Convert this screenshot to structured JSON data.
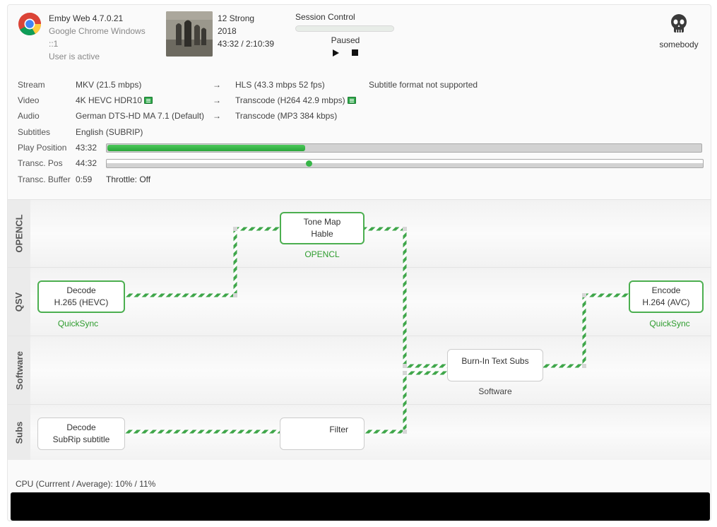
{
  "client": {
    "app": "Emby Web 4.7.0.21",
    "browser": "Google Chrome Windows",
    "address": "::1",
    "status": "User is active",
    "browser_icon": "chrome-icon"
  },
  "media": {
    "title": "12 Strong",
    "year": "2018",
    "time": "43:32 / 2:10:39"
  },
  "session": {
    "title": "Session Control",
    "state": "Paused",
    "play_icon": "play-icon",
    "stop_icon": "stop-icon"
  },
  "user": {
    "name": "somebody",
    "avatar_icon": "skull-icon"
  },
  "info": {
    "stream": {
      "label": "Stream",
      "source": "MKV (21.5 mbps)",
      "arrow": "→",
      "target": "HLS (43.3 mbps 52 fps)",
      "note": "Subtitle format not supported"
    },
    "video": {
      "label": "Video",
      "source": "4K HEVC HDR10",
      "arrow": "→",
      "target": "Transcode (H264 42.9 mbps)"
    },
    "audio": {
      "label": "Audio",
      "source": "German DTS-HD MA 7.1 (Default)",
      "arrow": "→",
      "target": "Transcode (MP3 384 kbps)"
    },
    "subtitles": {
      "label": "Subtitles",
      "source": "English (SUBRIP)"
    },
    "play_position": {
      "label": "Play Position",
      "value": "43:32",
      "progress": 0.333
    },
    "transc_pos": {
      "label": "Transc. Pos",
      "value": "44:32",
      "progress": 0.34
    },
    "transc_buffer": {
      "label": "Transc. Buffer",
      "value": "0:59",
      "throttle": "Throttle: Off"
    }
  },
  "pipeline": {
    "lanes": [
      "OPENCL",
      "QSV",
      "Software",
      "Subs"
    ],
    "nodes": {
      "tonemap": {
        "line1": "Tone Map",
        "line2": "Hable",
        "tag": "OPENCL"
      },
      "decode_video": {
        "line1": "Decode",
        "line2": "H.265 (HEVC)",
        "tag": "QuickSync"
      },
      "encode": {
        "line1": "Encode",
        "line2": "H.264 (AVC)",
        "tag": "QuickSync"
      },
      "burnin": {
        "line1": "Burn-In Text Subs",
        "tag": "Software"
      },
      "decode_subs": {
        "line1": "Decode",
        "line2": "SubRip subtitle"
      },
      "filter": {
        "line1": "Filter"
      }
    },
    "colors": {
      "active": "#4caf50",
      "wire": "#3fa64a"
    }
  },
  "cpu": {
    "text": "CPU (Currrent / Average): 10% / 11%"
  }
}
